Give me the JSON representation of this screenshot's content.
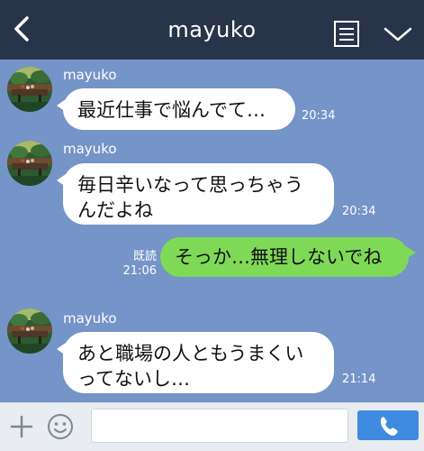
{
  "header": {
    "title": "mayuko"
  },
  "chat": {
    "messages": [
      {
        "direction": "incoming",
        "sender": "mayuko",
        "text": "最近仕事で悩んでて…",
        "time": "20:34"
      },
      {
        "direction": "incoming",
        "sender": "mayuko",
        "line1": "毎日辛いなって思っちゃう",
        "line2": "んだよね",
        "time": "20:34"
      },
      {
        "direction": "outgoing",
        "read_label": "既読",
        "text": "そっか…無理しないでね",
        "time": "21:06"
      },
      {
        "direction": "incoming",
        "sender": "mayuko",
        "line1": "あと職場の人ともうまくい",
        "line2": "ってないし…",
        "time": "21:14"
      }
    ]
  },
  "input": {
    "placeholder": ""
  },
  "icons": {
    "back": "back-chevron-icon",
    "menu": "menu-icon",
    "chevron_down": "chevron-down-icon",
    "plus": "plus-icon",
    "emoji": "emoji-icon",
    "call": "phone-icon"
  },
  "colors": {
    "header_bg": "#27344a",
    "chat_bg": "#7594c8",
    "incoming_bubble": "#ffffff",
    "outgoing_bubble": "#7ed957",
    "footer_bg": "#e9ecf0",
    "call_button": "#3f8be0"
  }
}
